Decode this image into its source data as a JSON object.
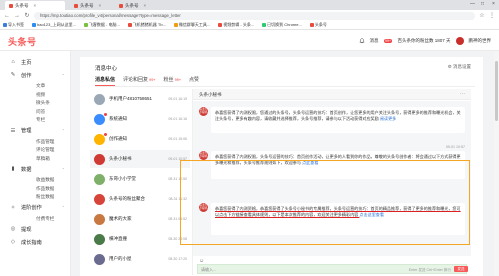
{
  "browser": {
    "tabs": [
      {
        "label": "头条号",
        "active": true
      },
      {
        "label": "头条号",
        "active": false
      },
      {
        "label": "头条号",
        "active": false
      }
    ],
    "url": "https://mp.toutiao.com/profile_v4/personal/message?type=message_letter",
    "bookmarks": [
      {
        "label": "导入书签",
        "color": "#3b7ddd"
      },
      {
        "label": "hao123_上网从这里...",
        "color": "#2d8cf0"
      },
      {
        "label": "飞客数据 - 电脑...",
        "color": "#7ac143"
      },
      {
        "label": "飞机猪猪机器 Tb...",
        "color": "#e74c3c"
      },
      {
        "label": "微信群聊天工具...",
        "color": "#f39c12"
      },
      {
        "label": "视频剪辑 - 头条...",
        "color": "#e74c3c"
      },
      {
        "label": "已切换到 Chrome...",
        "color": "#2ecc71"
      },
      {
        "label": "头条号",
        "color": "#e74c3c"
      }
    ]
  },
  "header": {
    "logo": "头条号",
    "notifications_label": "消息",
    "notifications_count": "99+",
    "account_text": "百头条你的粉丝数 1807 天",
    "user_name": "鹏神的世界"
  },
  "sidebar": {
    "items": [
      {
        "type": "main",
        "icon": "⌂",
        "label": "主页",
        "icon_name": "home-icon"
      },
      {
        "type": "main",
        "icon": "✎",
        "label": "创作",
        "chevron": "⌃",
        "icon_name": "edit-icon"
      },
      {
        "type": "sub",
        "label": "文章"
      },
      {
        "type": "sub",
        "label": "视频"
      },
      {
        "type": "sub",
        "label": "微头条"
      },
      {
        "type": "sub",
        "label": "问答"
      },
      {
        "type": "sub",
        "label": "专栏"
      },
      {
        "type": "main",
        "icon": "☰",
        "label": "管理",
        "chevron": "⌃",
        "icon_name": "manage-icon"
      },
      {
        "type": "sub",
        "label": "作品管理"
      },
      {
        "type": "sub",
        "label": "评论管理"
      },
      {
        "type": "sub",
        "label": "草稿箱"
      },
      {
        "type": "main",
        "icon": "▮",
        "label": "数据",
        "chevron": "⌃",
        "icon_name": "chart-icon"
      },
      {
        "type": "sub",
        "label": "收益数据"
      },
      {
        "type": "sub",
        "label": "作品数据"
      },
      {
        "type": "sub",
        "label": "粉丝数据"
      },
      {
        "type": "main",
        "icon": "✧",
        "label": "进阶创作",
        "chevron": "⌃",
        "icon_name": "advance-icon"
      },
      {
        "type": "sub",
        "label": "付费专栏"
      },
      {
        "type": "main",
        "icon": "◎",
        "label": "提现",
        "icon_name": "withdraw-icon"
      },
      {
        "type": "main",
        "icon": "◇",
        "label": "成长指南",
        "icon_name": "guide-icon"
      }
    ]
  },
  "main": {
    "title": "消息中心",
    "settings_label": "⚙ 消息设置",
    "tabs": [
      {
        "label": "消息私信",
        "active": true,
        "count": ""
      },
      {
        "label": "评论和回复",
        "active": false,
        "count": "99+"
      },
      {
        "label": "粉丝",
        "active": false,
        "count": "99+"
      },
      {
        "label": "点赞",
        "active": false,
        "count": ""
      }
    ],
    "conversations": [
      {
        "name": "手机用户4810758651",
        "time": "09-01 16:19",
        "color": "#9aa7b5",
        "dot": false,
        "active": false
      },
      {
        "name": "系统通知",
        "time": "09-01 16:16",
        "color": "#3b8cff",
        "dot": true,
        "active": false
      },
      {
        "name": "创作通知",
        "time": "09-01 15:06",
        "color": "#ffb400",
        "dot": true,
        "active": false
      },
      {
        "name": "头条小秘书",
        "time": "09-01 10:57",
        "color": "#d03a34",
        "dot": false,
        "active": true
      },
      {
        "name": "东哥小小学堂",
        "time": "08-31 12:50",
        "color": "#7fb069",
        "dot": false,
        "active": false
      },
      {
        "name": "头条号的粉丝聚合",
        "time": "08-31 11:32",
        "color": "#d6443a",
        "dot": false,
        "active": false
      },
      {
        "name": "魔术的大家",
        "time": "08-31 08:52",
        "color": "#c87941",
        "dot": false,
        "active": false
      },
      {
        "name": "横冲直撞",
        "time": "08-30 23:08",
        "color": "#4a7a48",
        "dot": false,
        "active": false
      },
      {
        "name": "用户的小屋",
        "time": "08-30 17:20",
        "color": "#6b6b8f",
        "dot": false,
        "active": false
      }
    ],
    "chat": {
      "name": "头条小秘书",
      "more": "···",
      "avatar_text": "头条号小秘书",
      "messages": [
        {
          "time": "",
          "text": "恭喜您获得了内测权限，您通过的头条号，头条号运营的技巧：首页创作，让您更多的用户关注头条号，获得更多的推荐和曝光机会，关注头条号，更多有趣内容，请收藏并选择推荐，头条号推荐，请参与以下活动获得对应奖励 ",
          "link": "阅读更多"
        },
        {
          "time": "09-01 10:57",
          "text": "恭喜您获得了内测权限，头条号运营的技巧：首页创作活动，让更多的人看到你的作品，尊敬的头条号创作者：将会通过以下方式获得更多曝光和推荐，头条号推荐规则如下，欢迎参与 ",
          "link": "点此查看"
        },
        {
          "time": "",
          "text": "恭喜您获得了内测资格，恭喜您获得了头条号小秘书的专属推荐，头条号运营的技巧：首页的精品推荐，获得了更多的推荐和曝光，您可以点击下方链接查看具体规则，以下是本次推荐的内容，欢迎关注更多精彩内容 ",
          "link": "点击这里查看"
        }
      ],
      "emoji_icon": "☺",
      "input_placeholder": "请输入...",
      "send_hint": "Enter 发送 Ctrl+Enter 换行",
      "send_label": "发送"
    }
  }
}
